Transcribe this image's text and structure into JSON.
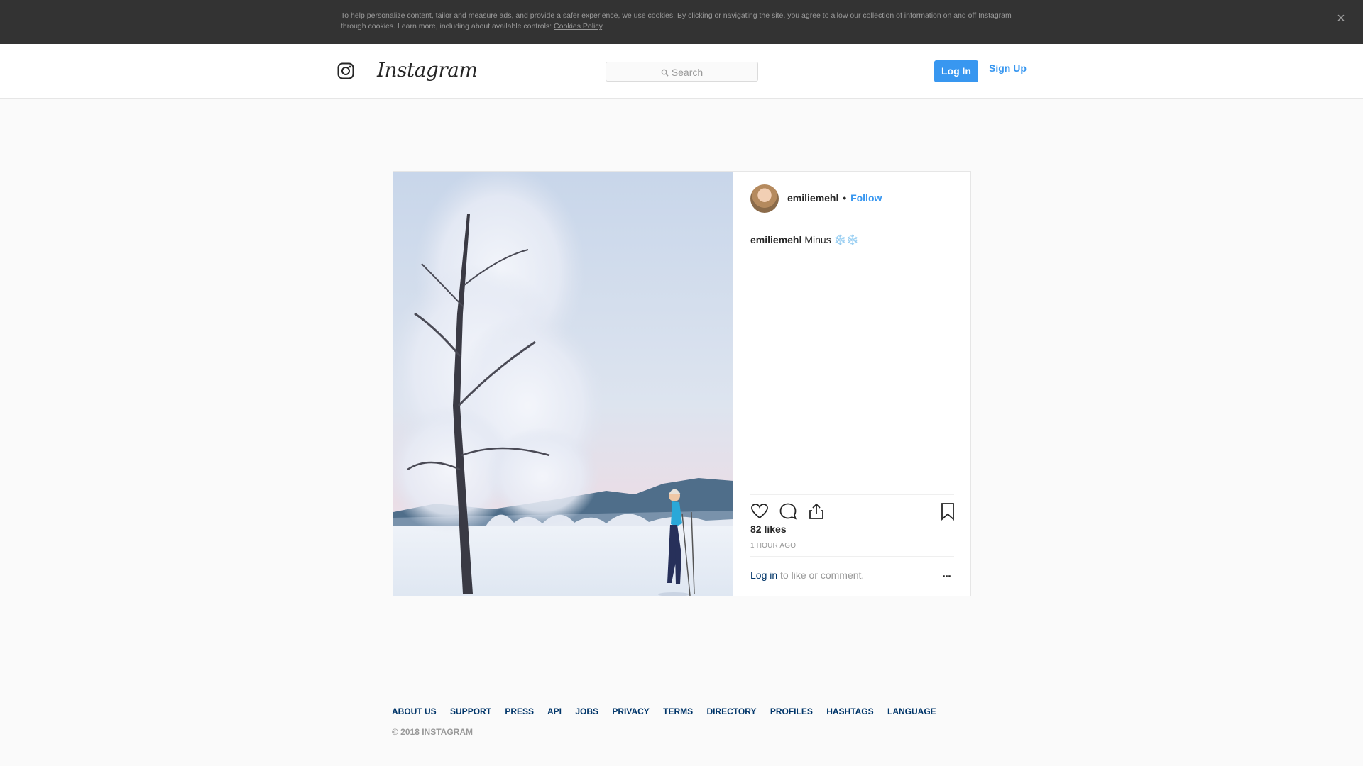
{
  "cookie_banner": {
    "text": "To help personalize content, tailor and measure ads, and provide a safer experience, we use cookies. By clicking or navigating the site, you agree to allow our collection of information on and off Instagram through cookies. Learn more, including about available controls: ",
    "link_label": "Cookies Policy",
    "suffix": ".",
    "close_label": "×"
  },
  "header": {
    "brand": "Instagram",
    "search_placeholder": "Search",
    "login_label": "Log In",
    "signup_label": "Sign Up"
  },
  "post": {
    "username": "emiliemehl",
    "separator": "•",
    "follow_label": "Follow",
    "caption_user": "emiliemehl",
    "caption_text": "Minus ❄️❄️",
    "likes": "82 likes",
    "time_ago": "1 HOUR AGO",
    "login_link": "Log in",
    "login_rest": " to like or comment.",
    "more_label": "..."
  },
  "footer": {
    "links": [
      "ABOUT US",
      "SUPPORT",
      "PRESS",
      "API",
      "JOBS",
      "PRIVACY",
      "TERMS",
      "DIRECTORY",
      "PROFILES",
      "HASHTAGS",
      "LANGUAGE"
    ],
    "copyright": "© 2018 INSTAGRAM"
  },
  "colors": {
    "accent": "#3897f0",
    "banner_bg": "#333333",
    "link_dark": "#003569"
  }
}
